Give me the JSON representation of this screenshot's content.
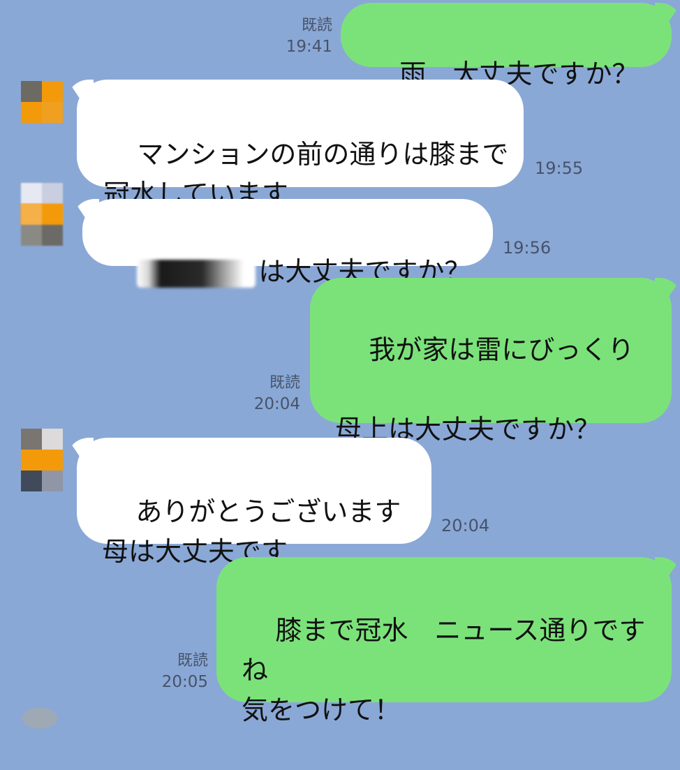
{
  "messages": [
    {
      "dir": "out",
      "text": "雨　大丈夫ですか？",
      "read": "既読",
      "time": "19:41"
    },
    {
      "dir": "in",
      "text": "マンションの前の通りは膝まで冠水しています…",
      "time": "19:55"
    },
    {
      "dir": "in",
      "text": "は大丈夫ですか？",
      "redacted": true,
      "time": "19:56"
    },
    {
      "dir": "out",
      "text": "我が家は雷にびっくり\n\n母上は大丈夫ですか？",
      "read": "既読",
      "time": "20:04"
    },
    {
      "dir": "in",
      "text": "ありがとうございます\n母は大丈夫です",
      "time": "20:04"
    },
    {
      "dir": "out",
      "text": "膝まで冠水　ニュース通りですね\n気をつけて！",
      "read": "既読",
      "time": "20:05"
    }
  ],
  "colors": {
    "background": "#8aa8d6",
    "outgoing_bubble": "#7be27a",
    "incoming_bubble": "#ffffff",
    "meta_text": "#46536a"
  }
}
